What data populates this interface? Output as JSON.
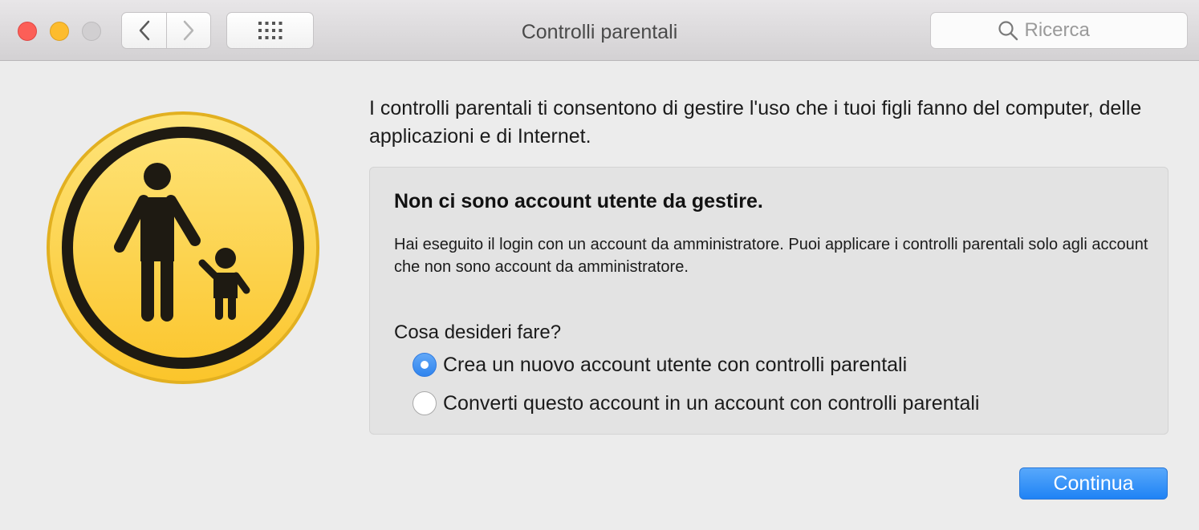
{
  "window": {
    "title": "Controlli parentali"
  },
  "toolbar": {
    "back_icon": "chevron-left-icon",
    "forward_icon": "chevron-right-icon",
    "grid_icon": "grid-icon"
  },
  "search": {
    "placeholder": "Ricerca",
    "value": "",
    "icon": "search-icon"
  },
  "main": {
    "intro": "I controlli parentali ti consentono di gestire l'uso che i tuoi figli fanno del computer, delle applicazioni e di Internet.",
    "panel": {
      "heading": "Non ci sono account utente da gestire.",
      "description": "Hai eseguito il login con un account da amministratore. Puoi applicare i controlli parentali solo agli account che non sono account da amministratore.",
      "question": "Cosa desideri fare?",
      "options": [
        {
          "label": "Crea un nuovo account utente con controlli parentali",
          "selected": true
        },
        {
          "label": "Converti questo account in un account con controlli parentali",
          "selected": false
        }
      ]
    },
    "continue_label": "Continua"
  },
  "colors": {
    "close": "#fc5f57",
    "minimize": "#fdbc2e",
    "accent": "#1f83f5",
    "icon_yellow": "#fcd24a"
  }
}
